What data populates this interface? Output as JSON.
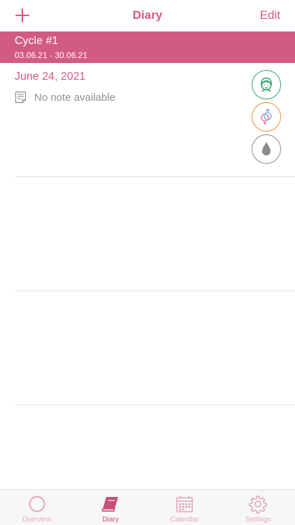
{
  "navbar": {
    "title": "Diary",
    "edit_label": "Edit",
    "add_icon": "plus-icon"
  },
  "cycle": {
    "title": "Cycle #1",
    "range": "03.06.21 - 30.06.21"
  },
  "entries": [
    {
      "date": "June 24, 2021",
      "note": "No note available",
      "badges": [
        "mood-face-icon",
        "sex-symbols-icon",
        "drop-icon"
      ]
    }
  ],
  "tabs": [
    {
      "label": "Overview",
      "icon": "circle-icon"
    },
    {
      "label": "Diary",
      "icon": "book-icon",
      "active": true
    },
    {
      "label": "Calendar",
      "icon": "calendar-icon"
    },
    {
      "label": "Settings",
      "icon": "gear-icon"
    }
  ],
  "colors": {
    "accent": "#d45a82",
    "cycle_bg": "#d15b83",
    "mood": "#2fa36b",
    "sex": "#e8912a",
    "flow": "#8b8b8b",
    "tab_inactive": "#e4a4ba"
  }
}
